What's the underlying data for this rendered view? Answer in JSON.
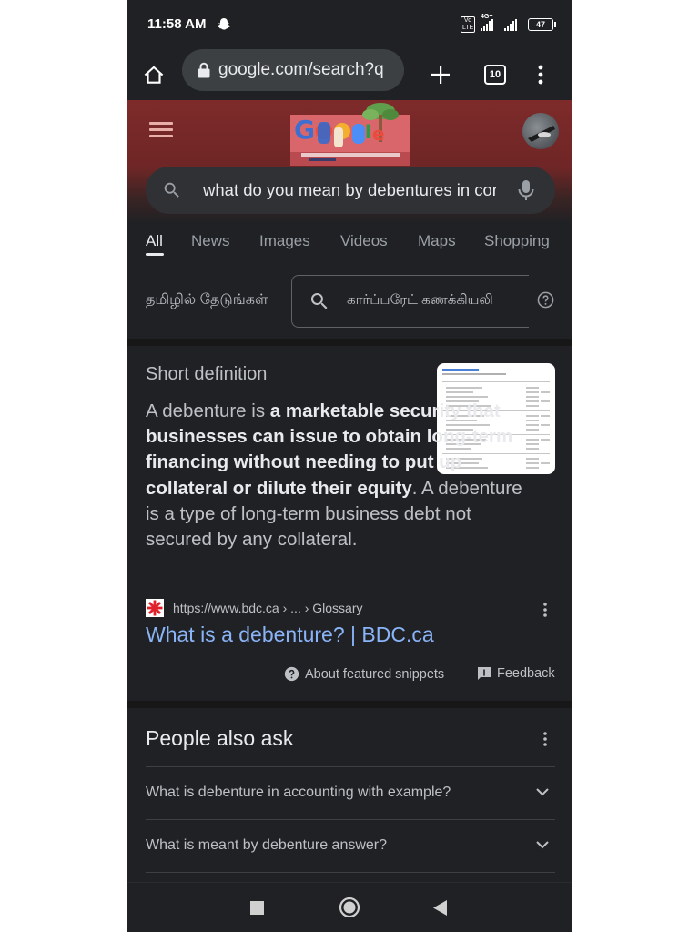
{
  "status_bar": {
    "time": "11:58 AM",
    "network_label": "4G+",
    "volte_label": "Vo LTE",
    "battery_level": "47"
  },
  "browser": {
    "url": "google.com/search?q",
    "tab_count": "10"
  },
  "search": {
    "query": "what do you mean by debentures in corporate accounting"
  },
  "tabs": [
    "All",
    "News",
    "Images",
    "Videos",
    "Maps",
    "Shopping"
  ],
  "tamil": {
    "label": "தமிழில் தேடுங்கள்",
    "query": "கார்ப்பரேட் கணக்கியலி"
  },
  "snippet": {
    "heading": "Short definition",
    "text_intro": "A debenture is ",
    "text_bold": "a marketable security that businesses can issue to obtain long-term financing without needing to put up collateral or dilute their equity",
    "text_rest": ". A debenture is a type of long-term business debt not secured by any collateral.",
    "source_url": "https://www.bdc.ca › ... › Glossary",
    "link_title": "What is a debenture? | BDC.ca",
    "about_label": "About featured snippets",
    "feedback_label": "Feedback"
  },
  "people_also_ask": {
    "title": "People also ask",
    "questions": [
      "What is debenture in accounting with example?",
      "What is meant by debenture answer?"
    ]
  },
  "colors": {
    "background": "#202124",
    "link": "#8ab4f8",
    "header_red": "#7e2a2a"
  },
  "icons": [
    "home-icon",
    "lock-icon",
    "plus-icon",
    "tab-switcher-icon",
    "overflow-menu-icon",
    "hamburger-menu-icon",
    "search-icon",
    "mic-icon",
    "help-circle-icon",
    "more-vert-icon",
    "feedback-icon",
    "chevron-down-icon",
    "recents-icon",
    "home-circle-icon",
    "back-icon"
  ]
}
